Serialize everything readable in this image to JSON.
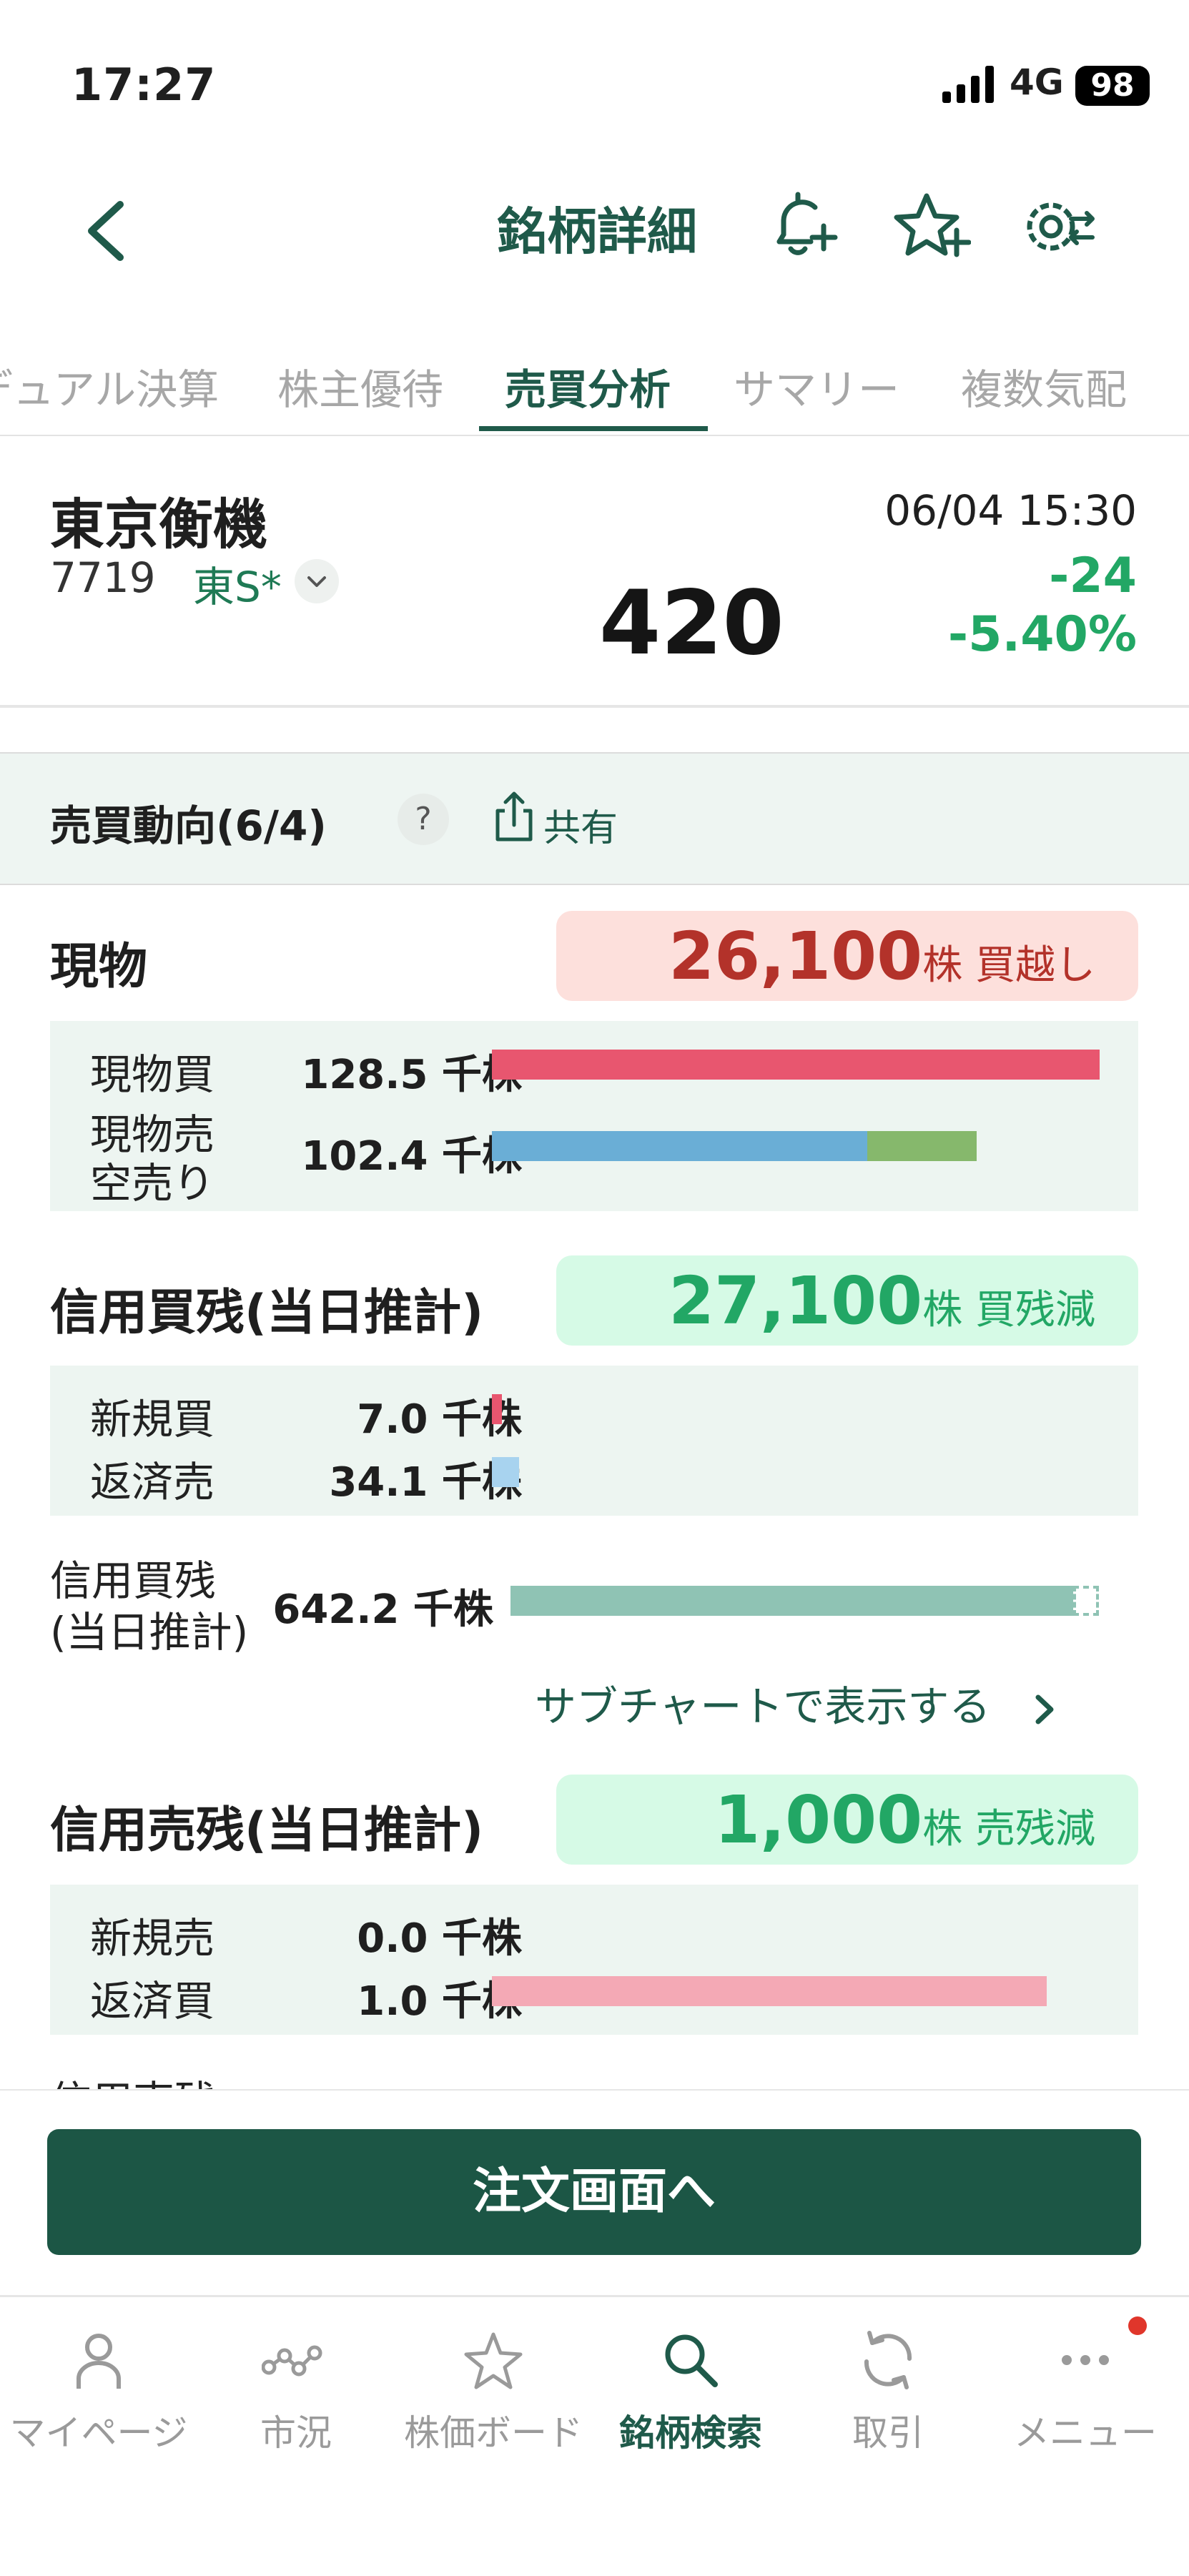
{
  "status": {
    "time": "17:27",
    "network": "4G",
    "battery": "98"
  },
  "header": {
    "title": "銘柄詳細",
    "icons": [
      "back-chevron-icon",
      "bell-plus-icon",
      "star-plus-icon",
      "gear-swap-icon"
    ]
  },
  "tabs": [
    "デュアル決算",
    "株主優待",
    "売買分析",
    "サマリー",
    "複数気配"
  ],
  "active_tab": "売買分析",
  "stock": {
    "name": "東京衡機",
    "code": "7719",
    "market": "東S*",
    "datetime": "06/04 15:30",
    "price": "420",
    "change": "-24",
    "change_pct": "-5.40%"
  },
  "section": {
    "title": "売買動向(6/4)",
    "help": "?",
    "share": "共有"
  },
  "genbutsu": {
    "label": "現物",
    "badge_value": "26,100",
    "badge_unit": "株 買越し",
    "buy_label": "現物買",
    "buy_value": "128.5 千株",
    "buy": 128.5,
    "sell_label": "現物売",
    "short_label": "空売り",
    "sell_value": "102.4 千株",
    "sell": 102.4,
    "sell_cash": 79.3,
    "sell_short": 23.1,
    "max": 128.5
  },
  "margin_buy": {
    "label": "信用買残(当日推計)",
    "badge_value": "27,100",
    "badge_unit": "株 買残減",
    "new_label": "新規買",
    "new_value": "7.0 千株",
    "new": 7.0,
    "repay_label": "返済売",
    "repay_value": "34.1 千株",
    "repay": 34.1,
    "balance_label_1": "信用買残",
    "balance_label_2": "(当日推計)",
    "balance_value": "642.2 千株",
    "balance": 642.2,
    "balance_prev": 669.3,
    "subchart_link": "サブチャートで表示する"
  },
  "margin_sell": {
    "label": "信用売残(当日推計)",
    "badge_value": "1,000",
    "badge_unit": "株 売残減",
    "new_label": "新規売",
    "new_value": "0.0 千株",
    "new": 0.0,
    "repay_label": "返済買",
    "repay_value": "1.0 千株",
    "repay": 1.0,
    "balance_label_1": "信用売残"
  },
  "order_button": "注文画面へ",
  "nav": [
    {
      "label": "マイページ",
      "icon": "person-icon"
    },
    {
      "label": "市況",
      "icon": "chart-nodes-icon"
    },
    {
      "label": "株価ボード",
      "icon": "star-icon"
    },
    {
      "label": "銘柄検索",
      "icon": "search-icon"
    },
    {
      "label": "取引",
      "icon": "refresh-icon"
    },
    {
      "label": "メニュー",
      "icon": "more-dots-icon"
    }
  ],
  "nav_active": "銘柄検索",
  "colors": {
    "brand": "#1f5a4a",
    "up": "#b3322a",
    "down": "#22a765",
    "buy_bar": "#e8566f",
    "sell_bar": "#6aaed6",
    "short_bar": "#86b86c",
    "margin_bar": "#8fc3b4",
    "sell_repay_bar": "#f4a9b5"
  }
}
